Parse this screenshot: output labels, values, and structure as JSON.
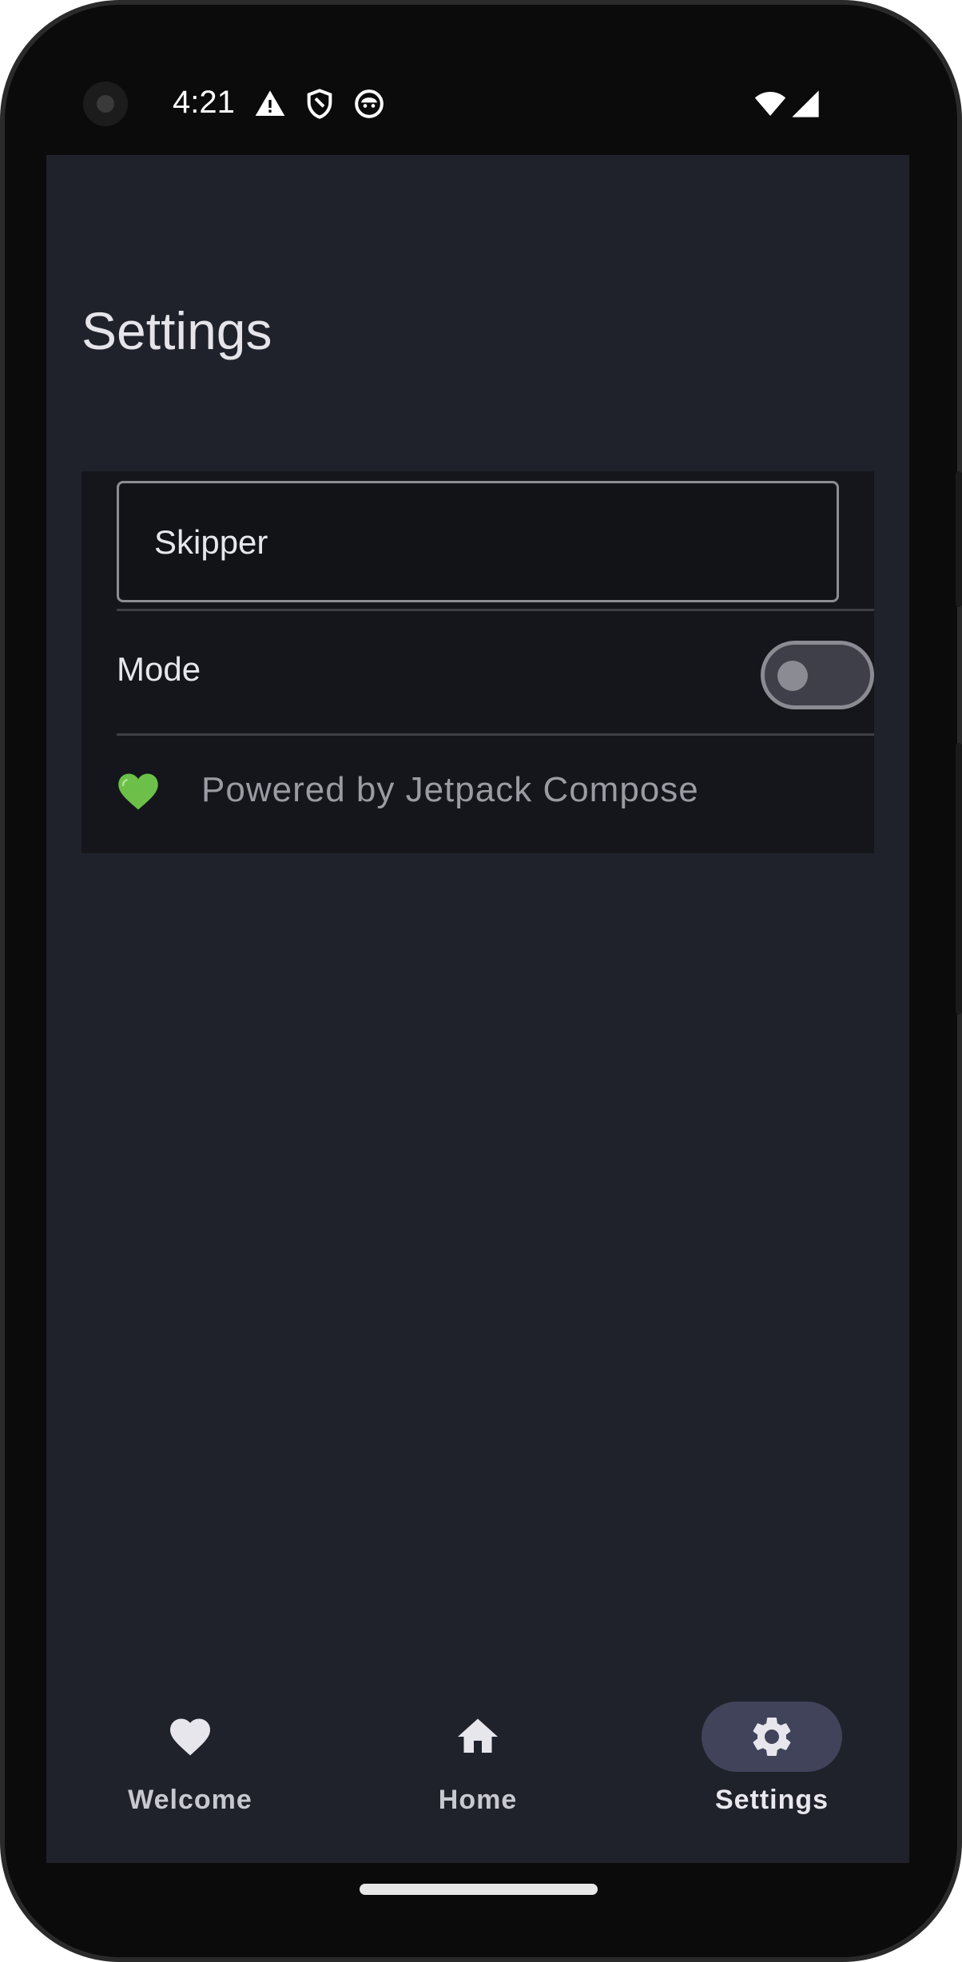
{
  "status_bar": {
    "time": "4:21"
  },
  "page": {
    "title": "Settings"
  },
  "settings": {
    "name_value": "Skipper",
    "mode_label": "Mode",
    "mode_enabled": false,
    "powered_by": "Powered by Jetpack Compose"
  },
  "nav": {
    "items": [
      {
        "label": "Welcome",
        "icon": "heart-icon",
        "selected": false
      },
      {
        "label": "Home",
        "icon": "home-icon",
        "selected": false
      },
      {
        "label": "Settings",
        "icon": "gear-icon",
        "selected": true
      }
    ]
  },
  "colors": {
    "background": "#20222b",
    "card": "#15161b",
    "accent_pill": "#40435a",
    "heart": "#6cc04a"
  }
}
